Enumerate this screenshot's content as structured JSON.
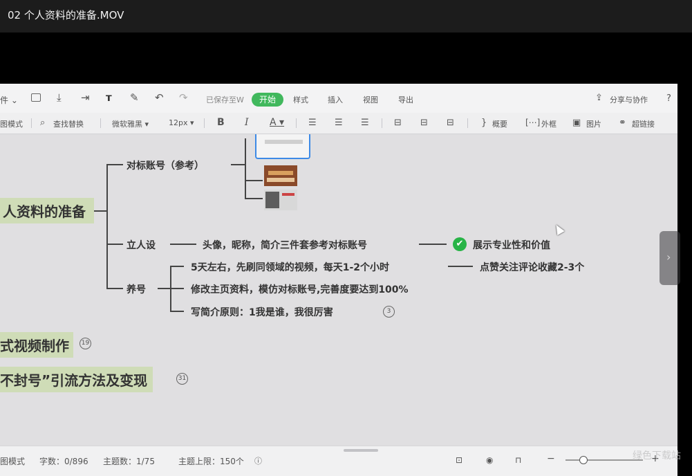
{
  "window": {
    "title": "02 个人资料的准备.MOV"
  },
  "toolbar": {
    "saved_text": "已保存至W",
    "tabs": [
      "开始",
      "样式",
      "插入",
      "视图",
      "导出"
    ],
    "active_tab": "开始",
    "share_label": "分享与协作",
    "help_icon": "?"
  },
  "format_bar": {
    "mode_label": "图模式",
    "find_label": "查找替换",
    "font_value": "微软雅黑",
    "size_value": "12px",
    "bold": "B",
    "italic": "I",
    "color": "A",
    "summary_label": "概要",
    "frame_label": "外框",
    "image_label": "图片",
    "link_label": "超链接"
  },
  "mindmap": {
    "root": "人资料的准备",
    "benchmark": "对标账号（参考）",
    "persona": "立人设",
    "persona_detail": "头像，昵称，简介三件套参考对标账号",
    "persona_result": "展示专业性和价值",
    "nurture": "养号",
    "nurture_items": [
      "5天左右，先刷同领域的视频，每天1-2个小时",
      "修改主页资料，模仿对标账号,完善度要达到100%",
      "写简介原则：1我是谁，我很厉害"
    ],
    "nurture_item1_result": "点赞关注评论收藏2-3个",
    "nurture_item3_count": "3",
    "video_topic": "式视频制作",
    "video_topic_count": "19",
    "traffic_topic": "不封号”引流方法及变现",
    "traffic_topic_count": "31"
  },
  "statusbar": {
    "mode": "图模式",
    "word_count": "字数：0/896",
    "topic_count": "主题数：1/75",
    "topic_limit": "主题上限：150个"
  },
  "watermark": "绿色下载站"
}
